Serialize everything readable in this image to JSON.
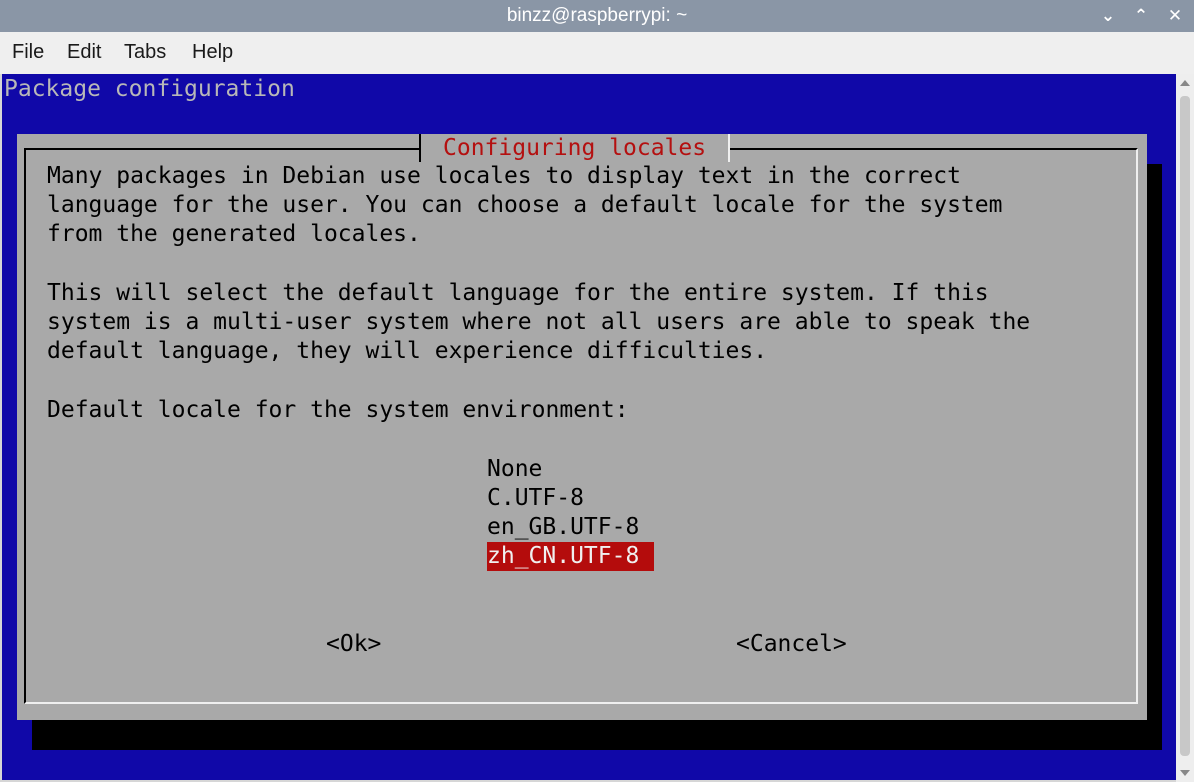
{
  "window": {
    "title": "binzz@raspberrypi: ~"
  },
  "menu": {
    "file": "File",
    "edit": "Edit",
    "tabs": "Tabs",
    "help": "Help"
  },
  "terminal": {
    "header": "Package configuration",
    "dialog": {
      "title": "Configuring locales",
      "para1": [
        "Many packages in Debian use locales to display text in the correct",
        "language for the user. You can choose a default locale for the system",
        "from the generated locales."
      ],
      "para2": [
        "This will select the default language for the entire system. If this",
        "system is a multi-user system where not all users are able to speak the",
        "default language, they will experience difficulties."
      ],
      "prompt": "Default locale for the system environment:",
      "options": [
        "None",
        "C.UTF-8",
        "en_GB.UTF-8",
        "zh_CN.UTF-8"
      ],
      "selected": "zh_CN.UTF-8",
      "ok": "<Ok>",
      "cancel": "<Cancel>"
    }
  },
  "colors": {
    "terminal_bg": "#1008a8",
    "dialog_bg": "#a9a9a9",
    "title_red": "#b41010",
    "selection_bg": "#b40c0c"
  }
}
